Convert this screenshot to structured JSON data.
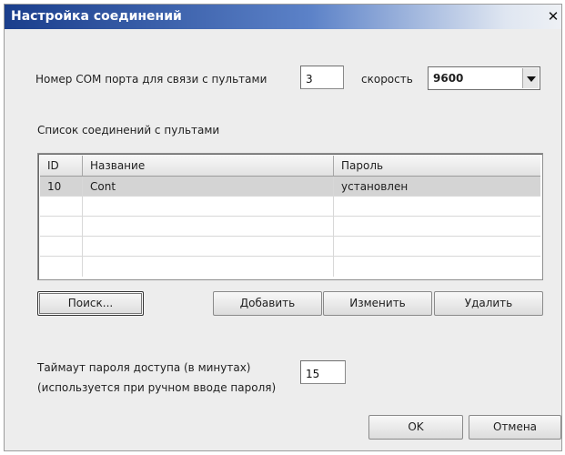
{
  "dialog": {
    "title": "Настройка соединений",
    "close_glyph": "✕"
  },
  "com": {
    "label": "Номер COM порта для связи с пультами",
    "port_value": "3",
    "speed_label": "скорость",
    "speed_value": "9600"
  },
  "connections": {
    "label": "Список соединений с пультами",
    "columns": [
      "ID",
      "Название",
      "Пароль"
    ],
    "rows": [
      {
        "id": "10",
        "name": "Cont",
        "password": "установлен"
      }
    ]
  },
  "buttons": {
    "search": "Поиск...",
    "add": "Добавить",
    "edit": "Изменить",
    "delete": "Удалить",
    "ok": "OK",
    "cancel": "Отмена"
  },
  "timeout": {
    "label_line1": "Таймаут пароля доступа (в минутах)",
    "label_line2": "(используется при ручном вводе пароля)",
    "value": "15"
  },
  "colors": {
    "title_bar_start": "#1a3e8c",
    "dialog_bg": "#ededed",
    "selected_row": "#d4d4d4"
  }
}
